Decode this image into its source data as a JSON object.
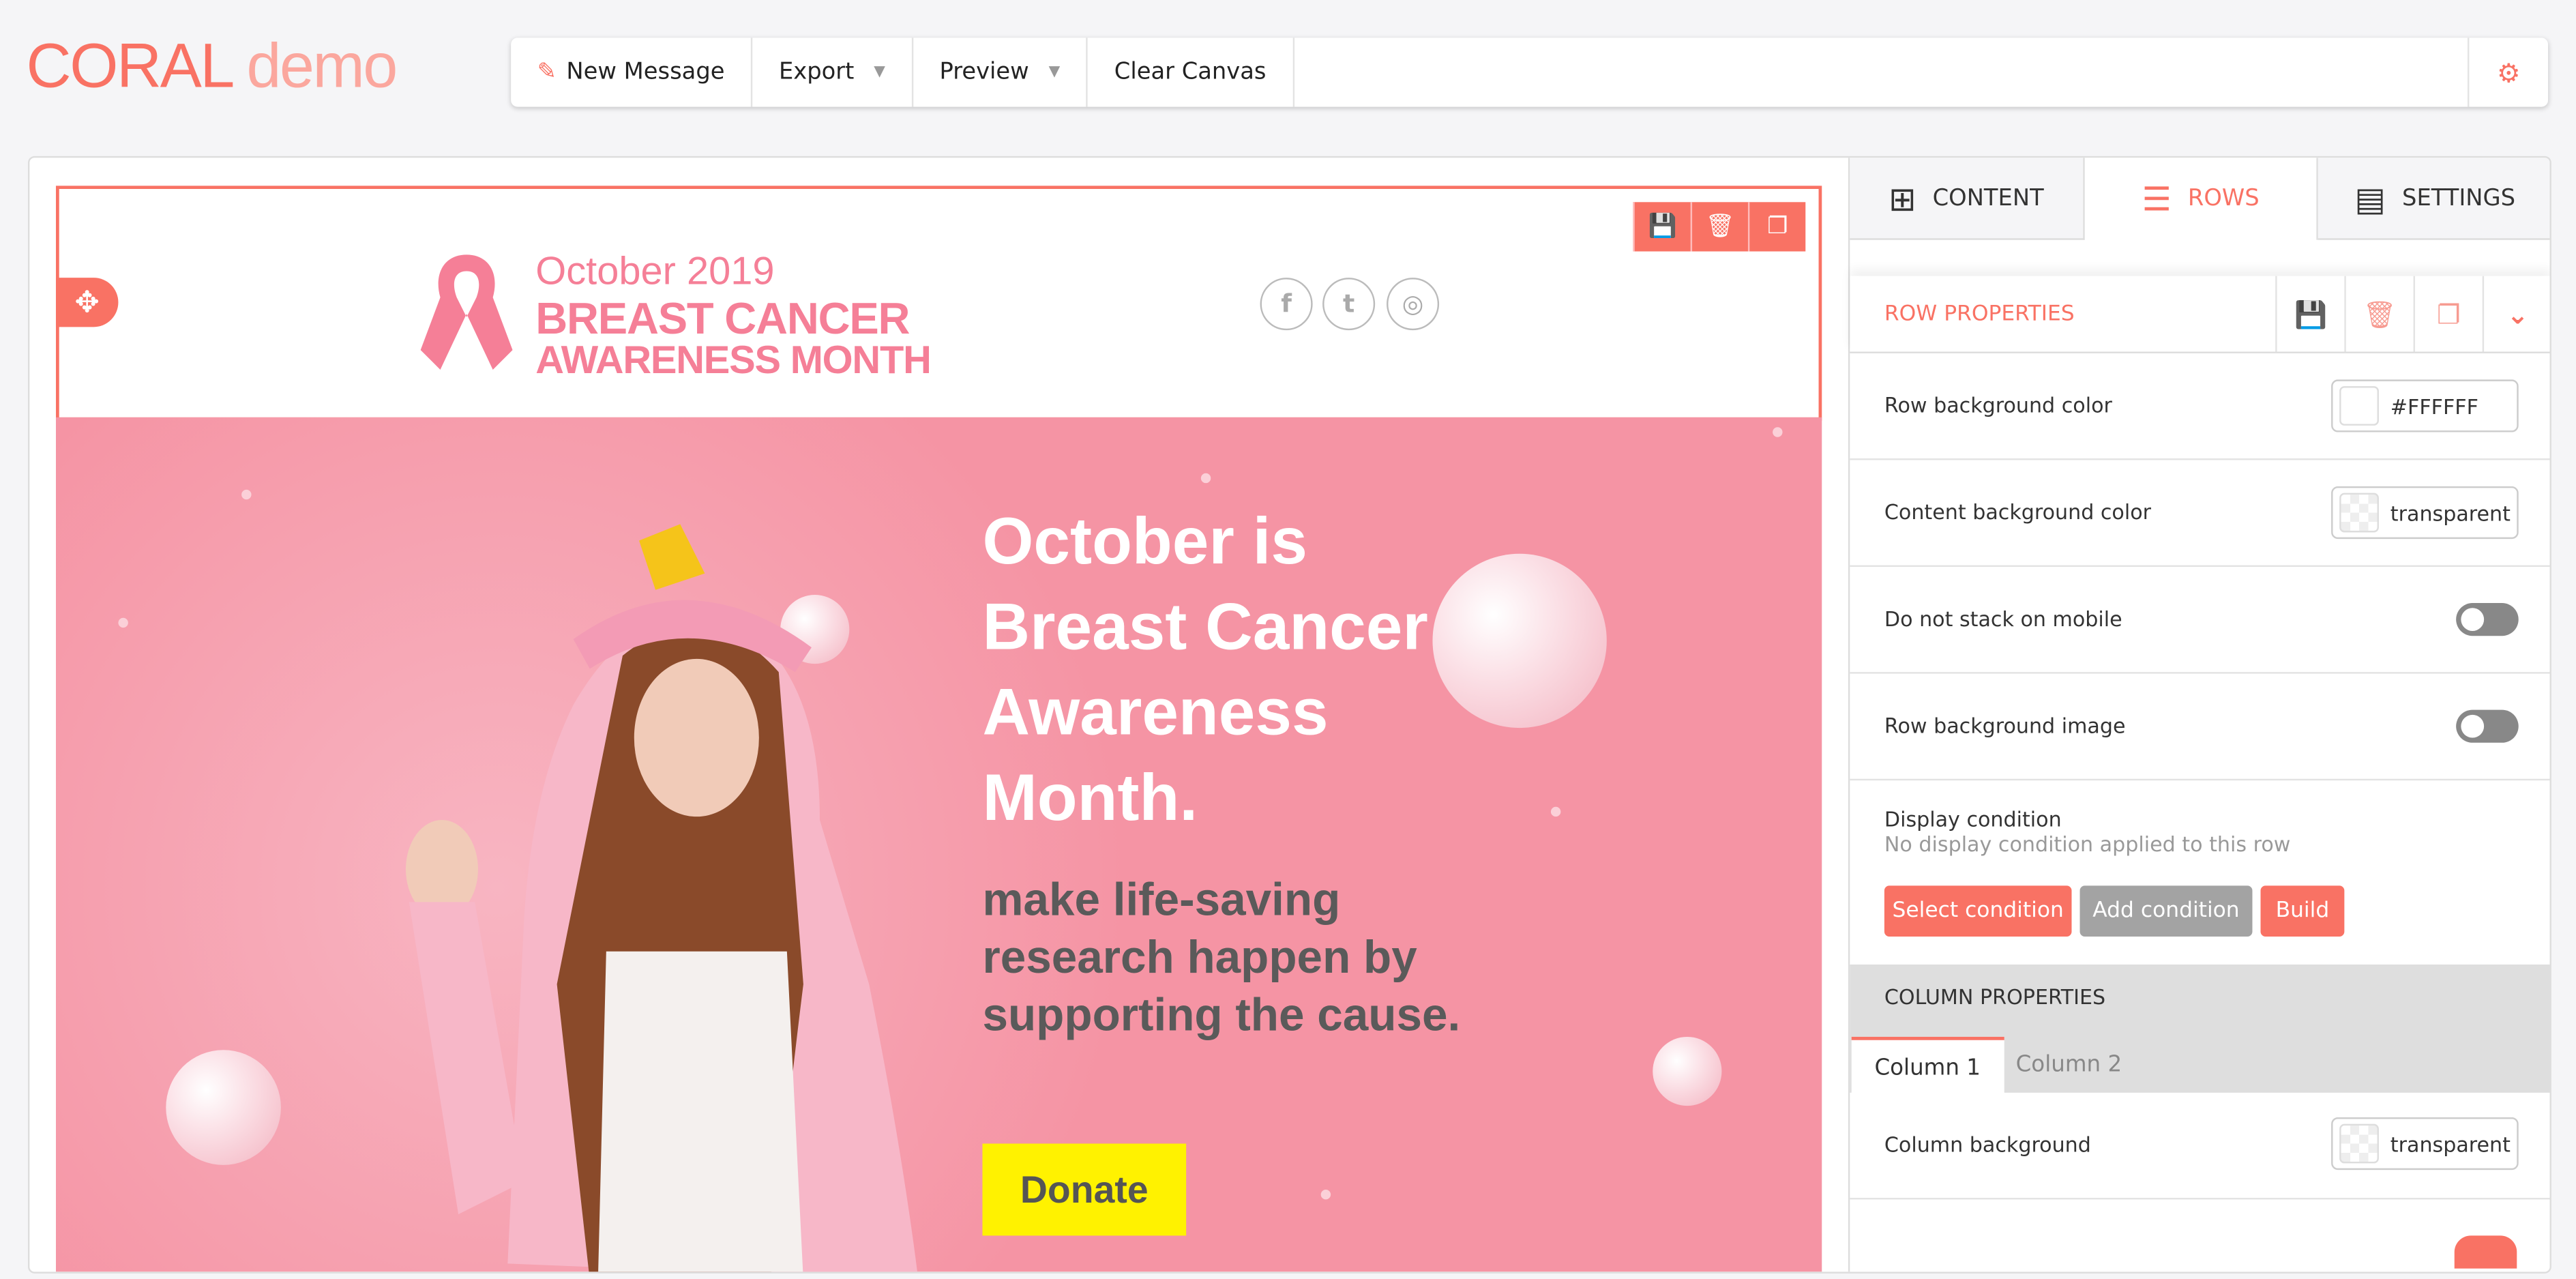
{
  "app": {
    "logo_main": "CORAL",
    "logo_sub": "demo"
  },
  "toolbar": {
    "new_message": "New Message",
    "export": "Export",
    "preview": "Preview",
    "clear_canvas": "Clear Canvas"
  },
  "email": {
    "header_date": "October 2019",
    "header_title1": "BREAST CANCER",
    "header_title2": "AWARENESS MONTH",
    "social": [
      "f",
      "t",
      "ig"
    ],
    "headline": "October is Breast Cancer Awareness Month.",
    "subline": "make life-saving research happen by supporting the cause.",
    "donate": "Donate"
  },
  "panel": {
    "tabs": [
      {
        "label": "CONTENT"
      },
      {
        "label": "ROWS"
      },
      {
        "label": "SETTINGS"
      }
    ],
    "row_properties": "ROW PROPERTIES",
    "row_bg_label": "Row background color",
    "row_bg_value": "#FFFFFF",
    "content_bg_label": "Content background color",
    "content_bg_value": "transparent",
    "no_stack_label": "Do not stack on mobile",
    "no_stack_on": false,
    "row_bg_image_label": "Row background image",
    "row_bg_image_on": false,
    "display_condition_label": "Display condition",
    "display_condition_note": "No display condition applied to this row",
    "select_condition": "Select condition",
    "add_condition": "Add condition",
    "build": "Build",
    "column_properties": "COLUMN PROPERTIES",
    "column_tabs": [
      "Column 1",
      "Column 2"
    ],
    "column_bg_label": "Column background",
    "column_bg_value": "transparent"
  },
  "colors": {
    "accent": "#f97264",
    "hero": "#f594a4",
    "donate": "#fff200"
  }
}
